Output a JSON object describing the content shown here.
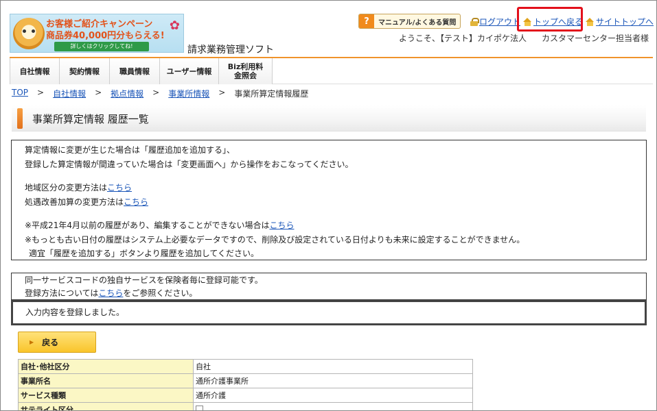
{
  "banner": {
    "line1": "お客様ご紹介キャンペーン",
    "line2": "商品券40,000円分もらえる!",
    "line3": "詳しくはクリックしてね!"
  },
  "app": {
    "title": "請求業務管理ソフト"
  },
  "header": {
    "manual_q": "?",
    "manual_label": "マニュアル/よくある質問",
    "logout": "ログアウト",
    "back_to_top": "トップへ戻る",
    "site_top": "サイトトップへ",
    "welcome": "ようこそ、【テスト】カイポケ法人",
    "staff": "カスタマーセンター担当者様"
  },
  "nav": {
    "tabs": [
      {
        "label": "自社情報"
      },
      {
        "label": "契約情報"
      },
      {
        "label": "職員情報"
      },
      {
        "label": "ユーザー情報"
      },
      {
        "label": "Biz利用料金照会"
      }
    ]
  },
  "breadcrumb": {
    "items": [
      "TOP",
      "自社情報",
      "拠点情報",
      "事業所情報",
      "事業所算定情報履歴"
    ],
    "separator": ">"
  },
  "page": {
    "title": "事業所算定情報 履歴一覧"
  },
  "info": {
    "line1": "算定情報に変更が生じた場合は「履歴追加を追加する」、",
    "line2": "登録した算定情報が間違っていた場合は「変更画面へ」から操作をおこなってください。",
    "line3_text": "地域区分の変更方法は",
    "line3_link": "こちら",
    "line4_text": "処遇改善加算の変更方法は",
    "line4_link": "こちら",
    "line5_text": "※平成21年4月以前の履歴があり、編集することができない場合は",
    "line5_link": "こちら",
    "line6": "※もっとも古い日付の履歴はシステム上必要なデータですので、削除及び設定されている日付よりも未来に設定することができません。",
    "line7": "適宜「履歴を追加する」ボタンより履歴を追加してください。"
  },
  "note": {
    "line1": "同一サービスコードの独自サービスを保険者毎に登録可能です。",
    "line2_pre": "登録方法については",
    "line2_link": "こちら",
    "line2_post": "をご参照ください。"
  },
  "message": {
    "text": "入力内容を登録しました。"
  },
  "back_button": {
    "label": "戻る"
  },
  "detail": {
    "rows": [
      {
        "key": "自社･他社区分",
        "value": "自社"
      },
      {
        "key": "事業所名",
        "value": "通所介護事業所"
      },
      {
        "key": "サービス種類",
        "value": "通所介護"
      },
      {
        "key": "サテライト区分",
        "value": ""
      }
    ]
  }
}
